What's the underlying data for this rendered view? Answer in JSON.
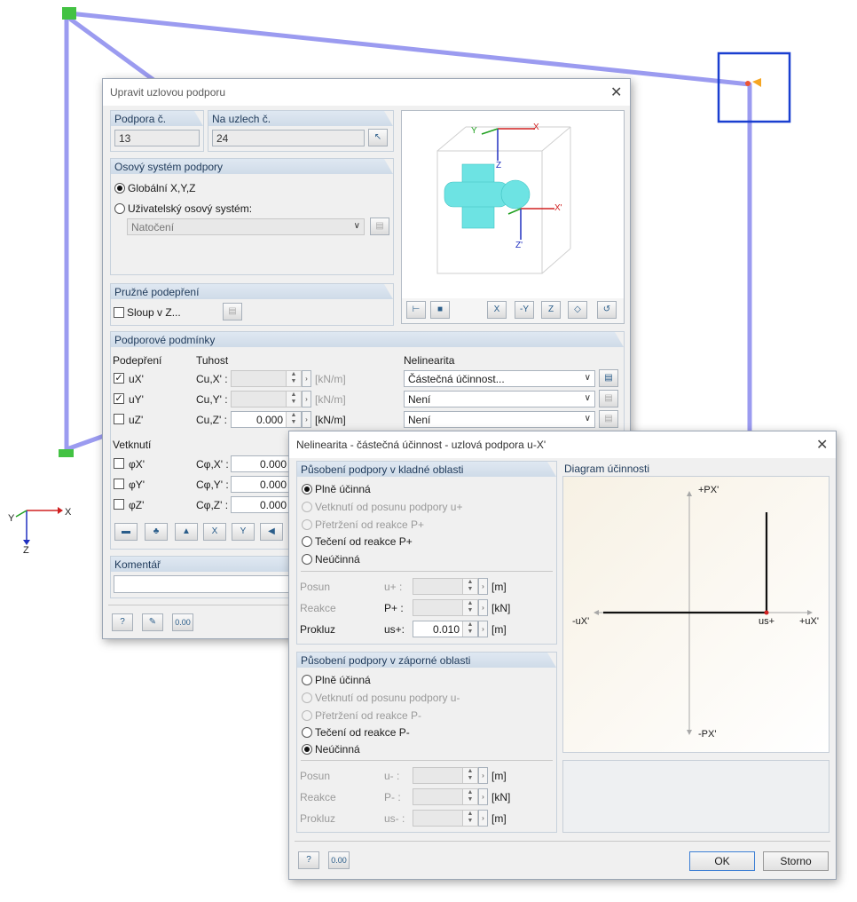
{
  "axes_legend": {
    "x": "X",
    "y": "Y",
    "z": "Z"
  },
  "main_dialog": {
    "title": "Upravit uzlovou podporu",
    "support_no": {
      "label": "Podpora č.",
      "value": "13"
    },
    "nodes": {
      "label": "Na uzlech č.",
      "value": "24"
    },
    "axis_system": {
      "header": "Osový systém podpory",
      "global": "Globální X,Y,Z",
      "user": "Uživatelský osový systém:",
      "rotation": "Natočení"
    },
    "elastic": {
      "header": "Pružné podepření",
      "column": "Sloup v Z..."
    },
    "conditions": {
      "header": "Podporové podmínky",
      "col_support": "Podepření",
      "col_stiffness": "Tuhost",
      "col_nonlin": "Nelinearita",
      "unit": "[kN/m]",
      "rows": [
        {
          "name": "uX'",
          "checked": true,
          "coef": "Cu,X' :",
          "value": "",
          "nonlin": "Částečná účinnost..."
        },
        {
          "name": "uY'",
          "checked": true,
          "coef": "Cu,Y' :",
          "value": "",
          "nonlin": "Není"
        },
        {
          "name": "uZ'",
          "checked": false,
          "coef": "Cu,Z' :",
          "value": "0.000",
          "nonlin": "Není"
        }
      ],
      "fixity_header": "Vetknutí",
      "fixity_rows": [
        {
          "name": "φX'",
          "coef": "Cφ,X' :",
          "value": "0.000"
        },
        {
          "name": "φY'",
          "coef": "Cφ,Y' :",
          "value": "0.000"
        },
        {
          "name": "φZ'",
          "coef": "Cφ,Z' :",
          "value": "0.000"
        }
      ]
    },
    "comment": {
      "header": "Komentář"
    },
    "preview_axes": {
      "x": "X",
      "y": "Y",
      "z": "Z",
      "xp": "X'",
      "zp": "Z'"
    }
  },
  "nl_dialog": {
    "title": "Nelinearita - částečná účinnost - uzlová podpora u-X'",
    "positive": {
      "header": "Působení podpory v kladné oblasti",
      "options": [
        "Plně účinná",
        "Vetknutí od posunu podpory u+",
        "Přetržení od reakce P+",
        "Tečení od reakce P+",
        "Neúčinná"
      ],
      "selected": 0,
      "fields": [
        {
          "label": "Posun",
          "sym": "u+ :",
          "value": "",
          "unit": "[m]",
          "enabled": false
        },
        {
          "label": "Reakce",
          "sym": "P+ :",
          "value": "",
          "unit": "[kN]",
          "enabled": false
        },
        {
          "label": "Prokluz",
          "sym": "us+:",
          "value": "0.010",
          "unit": "[m]",
          "enabled": true
        }
      ]
    },
    "negative": {
      "header": "Působení podpory v záporné oblasti",
      "options": [
        "Plně účinná",
        "Vetknutí od posunu podpory u-",
        "Přetržení od reakce P-",
        "Tečení od reakce P-",
        "Neúčinná"
      ],
      "selected": 4,
      "fields": [
        {
          "label": "Posun",
          "sym": "u- :",
          "value": "",
          "unit": "[m]",
          "enabled": false
        },
        {
          "label": "Reakce",
          "sym": "P- :",
          "value": "",
          "unit": "[kN]",
          "enabled": false
        },
        {
          "label": "Prokluz",
          "sym": "us- :",
          "value": "",
          "unit": "[m]",
          "enabled": false
        }
      ]
    },
    "diagram": {
      "header": "Diagram účinnosti",
      "px_pos": "+PX'",
      "px_neg": "-PX'",
      "ux_neg": "-uX'",
      "ux_pos": "+uX'",
      "us": "us+"
    },
    "ok": "OK",
    "cancel": "Storno"
  },
  "colors": {
    "member": "#9b9bf0",
    "highlight": "#1a3fd0",
    "accent": "#2a5d8a"
  }
}
